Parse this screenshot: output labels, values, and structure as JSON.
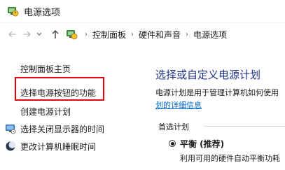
{
  "window": {
    "title": "电源选项",
    "icon": "power-options-icon"
  },
  "address_bar": {
    "back_icon": "back-arrow-icon",
    "forward_icon": "forward-arrow-icon",
    "dropdown_icon": "chevron-down-icon",
    "up_icon": "up-arrow-icon",
    "breadcrumb": [
      "控制面板",
      "硬件和声音",
      "电源选项"
    ],
    "separator": "›"
  },
  "sidebar": {
    "items": [
      {
        "label": "控制面板主页"
      },
      {
        "label": "选择电源按钮的功能",
        "highlighted": true,
        "highlight_color": "#e3000f"
      },
      {
        "label": "创建电源计划"
      },
      {
        "label": "选择关闭显示器的时间",
        "icon": "monitor-icon"
      },
      {
        "label": "更改计算机睡眠时间",
        "icon": "moon-icon"
      }
    ]
  },
  "main": {
    "heading": "选择或自定义电源计划",
    "description": "电源计划是用于管理计算机如何使用",
    "description_link": "划的详细信息",
    "section_label": "首选计划",
    "plans": [
      {
        "name": "平衡 (推荐)",
        "selected": true,
        "description": "利用可用的硬件自动平衡功耗"
      }
    ]
  },
  "colors": {
    "heading": "#1e3287",
    "link": "#0066cc",
    "highlight_box": "#e3000f"
  }
}
